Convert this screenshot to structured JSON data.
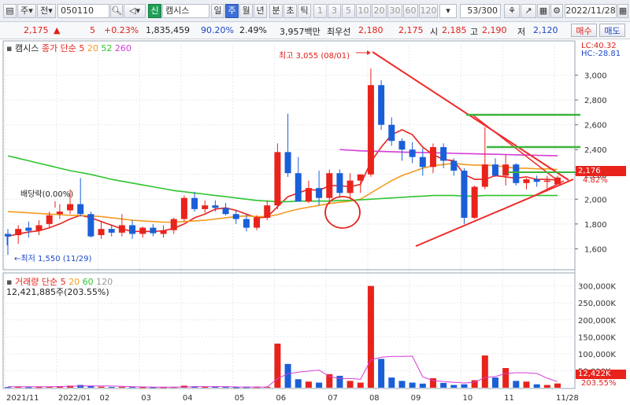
{
  "toolbar": {
    "market": "주",
    "prev": "전",
    "code": "050110",
    "credit_badge": "신",
    "name": "캠시스",
    "periods": [
      "일",
      "주",
      "월",
      "년",
      "분",
      "초",
      "틱"
    ],
    "active_period": "주",
    "intervals": [
      "1",
      "3",
      "5",
      "10",
      "20",
      "30",
      "60",
      "120"
    ],
    "page_count": "53/300",
    "date": "2022/11/28"
  },
  "quote": {
    "price": "2,175",
    "arrow": "▲",
    "change": "5",
    "change_pct": "+0.23%",
    "volume": "1,835,459",
    "ratio1": "90.20%",
    "ratio2": "2.49%",
    "amount": "3,957백만",
    "best_label": "최우선",
    "ask": "2,180",
    "bid": "2,175",
    "open_label": "시",
    "open": "2,185",
    "high_label": "고",
    "high": "2,190",
    "low_label": "저",
    "low": "2,120",
    "buy_label": "매수",
    "sell_label": "매도"
  },
  "price_panel": {
    "legend_name": "캠시스",
    "legend_ma": "종가 단순",
    "ma_periods": [
      "5",
      "20",
      "52",
      "260"
    ],
    "lc": "LC:40.32",
    "hc": "HC:-28.81",
    "annot_high": "최고 3,055 (08/01)",
    "annot_low": "←최저 1,550 (11/29)",
    "annot_div": "배당락(0.00%)",
    "last_price_tag": "2,176",
    "last_pct_tag": "4.82%"
  },
  "volume_panel": {
    "legend_name": "거래량",
    "legend_ma": "단순",
    "ma_periods": [
      "5",
      "20",
      "60",
      "120"
    ],
    "last_volume": "12,421,885주(203.55%)",
    "last_tag": "12,422K",
    "last_pct_tag": "203.55%"
  },
  "colors": {
    "up": "#e8231c",
    "down": "#1a5fd8",
    "ma5": "#e8231c",
    "ma20": "#f39a1e",
    "ma52": "#2ec42e",
    "ma260": "#d63bd6",
    "trendline": "#ef2a2a",
    "hline": "#3cb43c"
  },
  "chart_data": [
    {
      "type": "candlestick",
      "title": "캠시스",
      "ylim": [
        1450,
        3150
      ],
      "yticks": [
        1600,
        1800,
        2000,
        2200,
        2400,
        2600,
        2800,
        3000
      ],
      "x_ticks": [
        {
          "i": 0,
          "label": "2021/11"
        },
        {
          "i": 5,
          "label": "2022/01"
        },
        {
          "i": 9,
          "label": "02"
        },
        {
          "i": 13,
          "label": "03"
        },
        {
          "i": 17,
          "label": "04"
        },
        {
          "i": 22,
          "label": "05"
        },
        {
          "i": 26,
          "label": "06"
        },
        {
          "i": 31,
          "label": "07"
        },
        {
          "i": 35,
          "label": "08"
        },
        {
          "i": 39,
          "label": "09"
        },
        {
          "i": 44,
          "label": "10"
        },
        {
          "i": 48,
          "label": "11"
        },
        {
          "i": 53,
          "label": "11/28"
        }
      ],
      "candles": [
        {
          "o": 1720,
          "h": 1760,
          "l": 1550,
          "c": 1700
        },
        {
          "o": 1710,
          "h": 1790,
          "l": 1640,
          "c": 1760
        },
        {
          "o": 1770,
          "h": 1820,
          "l": 1690,
          "c": 1745
        },
        {
          "o": 1745,
          "h": 1830,
          "l": 1710,
          "c": 1790
        },
        {
          "o": 1800,
          "h": 1900,
          "l": 1770,
          "c": 1870
        },
        {
          "o": 1880,
          "h": 1960,
          "l": 1840,
          "c": 1900
        },
        {
          "o": 1910,
          "h": 2080,
          "l": 1880,
          "c": 1960
        },
        {
          "o": 1960,
          "h": 2170,
          "l": 1860,
          "c": 1880
        },
        {
          "o": 1880,
          "h": 1900,
          "l": 1690,
          "c": 1700
        },
        {
          "o": 1710,
          "h": 1820,
          "l": 1680,
          "c": 1760
        },
        {
          "o": 1760,
          "h": 1790,
          "l": 1700,
          "c": 1730
        },
        {
          "o": 1730,
          "h": 1880,
          "l": 1700,
          "c": 1790
        },
        {
          "o": 1790,
          "h": 1830,
          "l": 1680,
          "c": 1720
        },
        {
          "o": 1720,
          "h": 1780,
          "l": 1690,
          "c": 1770
        },
        {
          "o": 1770,
          "h": 1800,
          "l": 1700,
          "c": 1725
        },
        {
          "o": 1720,
          "h": 1790,
          "l": 1690,
          "c": 1750
        },
        {
          "o": 1750,
          "h": 1850,
          "l": 1720,
          "c": 1840
        },
        {
          "o": 1840,
          "h": 2030,
          "l": 1820,
          "c": 2010
        },
        {
          "o": 2010,
          "h": 2060,
          "l": 1900,
          "c": 1920
        },
        {
          "o": 1920,
          "h": 1990,
          "l": 1890,
          "c": 1950
        },
        {
          "o": 1950,
          "h": 1990,
          "l": 1900,
          "c": 1930
        },
        {
          "o": 1930,
          "h": 1970,
          "l": 1870,
          "c": 1880
        },
        {
          "o": 1880,
          "h": 1910,
          "l": 1800,
          "c": 1840
        },
        {
          "o": 1840,
          "h": 1880,
          "l": 1740,
          "c": 1770
        },
        {
          "o": 1770,
          "h": 1870,
          "l": 1750,
          "c": 1850
        },
        {
          "o": 1850,
          "h": 1990,
          "l": 1830,
          "c": 1950
        },
        {
          "o": 1950,
          "h": 2450,
          "l": 1920,
          "c": 2380
        },
        {
          "o": 2380,
          "h": 2690,
          "l": 2180,
          "c": 2210
        },
        {
          "o": 2210,
          "h": 2340,
          "l": 1990,
          "c": 1980
        },
        {
          "o": 1980,
          "h": 2150,
          "l": 1970,
          "c": 2090
        },
        {
          "o": 2090,
          "h": 2230,
          "l": 1950,
          "c": 2010
        },
        {
          "o": 2010,
          "h": 2240,
          "l": 1960,
          "c": 2210
        },
        {
          "o": 2210,
          "h": 2240,
          "l": 2010,
          "c": 2050
        },
        {
          "o": 2050,
          "h": 2210,
          "l": 2000,
          "c": 2150
        },
        {
          "o": 2150,
          "h": 2190,
          "l": 2050,
          "c": 2200
        },
        {
          "o": 2200,
          "h": 3055,
          "l": 2180,
          "c": 2920
        },
        {
          "o": 2920,
          "h": 2960,
          "l": 2560,
          "c": 2600
        },
        {
          "o": 2600,
          "h": 2660,
          "l": 2430,
          "c": 2470
        },
        {
          "o": 2470,
          "h": 2490,
          "l": 2310,
          "c": 2400
        },
        {
          "o": 2400,
          "h": 2460,
          "l": 2290,
          "c": 2340
        },
        {
          "o": 2340,
          "h": 2410,
          "l": 2190,
          "c": 2260
        },
        {
          "o": 2260,
          "h": 2450,
          "l": 2210,
          "c": 2420
        },
        {
          "o": 2420,
          "h": 2450,
          "l": 2250,
          "c": 2310
        },
        {
          "o": 2310,
          "h": 2330,
          "l": 2190,
          "c": 2230
        },
        {
          "o": 2230,
          "h": 2250,
          "l": 1800,
          "c": 1850
        },
        {
          "o": 1850,
          "h": 2110,
          "l": 1840,
          "c": 2100
        },
        {
          "o": 2100,
          "h": 2580,
          "l": 2080,
          "c": 2280
        },
        {
          "o": 2280,
          "h": 2330,
          "l": 2180,
          "c": 2190
        },
        {
          "o": 2190,
          "h": 2360,
          "l": 2110,
          "c": 2280
        },
        {
          "o": 2280,
          "h": 2290,
          "l": 2110,
          "c": 2130
        },
        {
          "o": 2130,
          "h": 2170,
          "l": 2080,
          "c": 2160
        },
        {
          "o": 2160,
          "h": 2190,
          "l": 2100,
          "c": 2140
        },
        {
          "o": 2140,
          "h": 2190,
          "l": 2080,
          "c": 2150
        },
        {
          "o": 2120,
          "h": 2190,
          "l": 2120,
          "c": 2175
        }
      ],
      "ma": {
        "5": [
          1700,
          1720,
          1735,
          1745,
          1770,
          1800,
          1840,
          1870,
          1850,
          1820,
          1790,
          1760,
          1740,
          1740,
          1740,
          1745,
          1765,
          1800,
          1850,
          1880,
          1920,
          1930,
          1910,
          1880,
          1850,
          1855,
          1940,
          2020,
          2050,
          2080,
          2070,
          2110,
          2110,
          2100,
          2120,
          2300,
          2420,
          2520,
          2560,
          2520,
          2420,
          2360,
          2320,
          2310,
          2200,
          2160,
          2160,
          2190,
          2180,
          2170,
          2180,
          2160,
          2160,
          2155
        ],
        "20": [
          1900,
          1895,
          1890,
          1885,
          1880,
          1875,
          1870,
          1870,
          1865,
          1860,
          1850,
          1840,
          1830,
          1825,
          1820,
          1815,
          1815,
          1820,
          1825,
          1830,
          1840,
          1850,
          1860,
          1865,
          1860,
          1860,
          1875,
          1900,
          1920,
          1935,
          1950,
          1965,
          1975,
          1985,
          2000,
          2050,
          2100,
          2150,
          2190,
          2220,
          2250,
          2270,
          2280,
          2290,
          2280,
          2275,
          2275,
          2270,
          2260,
          2250,
          2250,
          2245,
          2245,
          2240
        ],
        "52": [
          2350,
          2330,
          2310,
          2290,
          2270,
          2250,
          2230,
          2215,
          2200,
          2180,
          2160,
          2145,
          2130,
          2115,
          2100,
          2085,
          2070,
          2060,
          2050,
          2040,
          2030,
          2020,
          2010,
          2000,
          1990,
          1985,
          1980,
          1980,
          1985,
          1985,
          1985,
          1985,
          1990,
          1990,
          1995,
          2000,
          2005,
          2010,
          2015,
          2020,
          2025,
          2030,
          2030,
          2030,
          2025,
          2025,
          2030,
          2030,
          2030,
          2030,
          2030,
          2030,
          2030,
          2030
        ],
        "260": [
          null,
          null,
          null,
          null,
          null,
          null,
          null,
          null,
          null,
          null,
          null,
          null,
          null,
          null,
          null,
          null,
          null,
          null,
          null,
          null,
          null,
          null,
          null,
          null,
          null,
          null,
          null,
          null,
          null,
          null,
          null,
          null,
          2400,
          2395,
          2390,
          2388,
          2385,
          2383,
          2380,
          2378,
          2376,
          2374,
          2372,
          2370,
          2368,
          2366,
          2364,
          2362,
          2360,
          2358,
          2356,
          2354,
          2352,
          2350
        ]
      }
    },
    {
      "type": "bar",
      "title": "거래량",
      "ylim": [
        0,
        320000
      ],
      "yticks": [
        50000,
        100000,
        150000,
        200000,
        250000,
        300000
      ],
      "ytick_labels": [
        "50,000K",
        "100,000K",
        "150,000K",
        "200,000K",
        "250,000K",
        "300,000K"
      ],
      "units": "K",
      "values": [
        2000,
        2500,
        1500,
        1800,
        3000,
        4000,
        6000,
        8000,
        5000,
        3000,
        2000,
        2500,
        2000,
        1500,
        1500,
        1600,
        2000,
        6000,
        4000,
        2000,
        2500,
        2000,
        1500,
        1800,
        2000,
        2500,
        130000,
        70000,
        25000,
        18000,
        15000,
        40000,
        35000,
        20000,
        15000,
        300000,
        85000,
        30000,
        20000,
        15000,
        12000,
        28000,
        14000,
        8000,
        10000,
        22000,
        95000,
        30000,
        58000,
        20000,
        18000,
        10000,
        8000,
        12422
      ],
      "ma_line": [
        3000,
        3000,
        3000,
        2800,
        2900,
        3500,
        4200,
        5200,
        5400,
        5200,
        4800,
        4000,
        3000,
        2300,
        1900,
        1800,
        1800,
        2400,
        3000,
        3200,
        3300,
        3300,
        2400,
        2200,
        2000,
        2000,
        27000,
        41000,
        46000,
        49000,
        52000,
        33000,
        27000,
        27000,
        25000,
        82000,
        90000,
        92000,
        92000,
        93000,
        32000,
        21000,
        18000,
        16000,
        14000,
        16000,
        30000,
        33000,
        42000,
        44000,
        44000,
        42000,
        28000,
        18000
      ]
    }
  ]
}
